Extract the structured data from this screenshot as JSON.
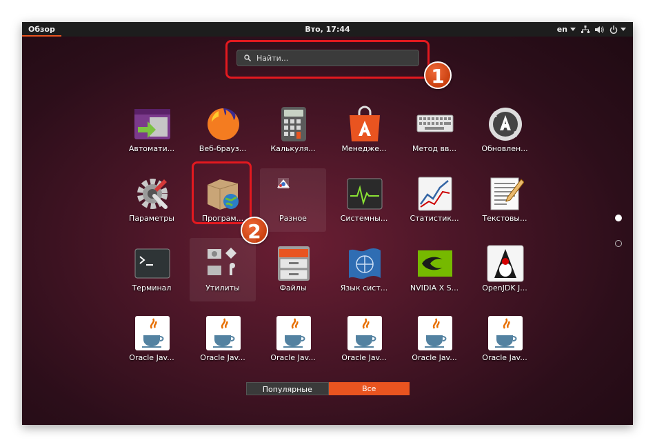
{
  "topbar": {
    "activities": "Обзор",
    "clock": "Вто, 17:44",
    "lang": "en"
  },
  "search": {
    "placeholder": "Найти..."
  },
  "markers": {
    "one": "1",
    "two": "2"
  },
  "apps": [
    {
      "label": "Автомати...",
      "icon": "settings-switcher-icon"
    },
    {
      "label": "Веб-брауз...",
      "icon": "firefox-icon"
    },
    {
      "label": "Калькуля...",
      "icon": "calculator-icon"
    },
    {
      "label": "Менедже...",
      "icon": "software-center-icon"
    },
    {
      "label": "Метод вв...",
      "icon": "keyboard-icon"
    },
    {
      "label": "Обновлен...",
      "icon": "software-updater-icon"
    },
    {
      "label": "Параметры",
      "icon": "settings-gear-icon"
    },
    {
      "label": "Програм...",
      "icon": "software-properties-icon"
    },
    {
      "label": "Разное",
      "icon": "folder-misc-icon"
    },
    {
      "label": "Системны...",
      "icon": "system-monitor-icon"
    },
    {
      "label": "Статистик...",
      "icon": "power-statistics-icon"
    },
    {
      "label": "Текстовы...",
      "icon": "text-editor-icon"
    },
    {
      "label": "Терминал",
      "icon": "terminal-icon"
    },
    {
      "label": "Утилиты",
      "icon": "folder-utilities-icon"
    },
    {
      "label": "Файлы",
      "icon": "files-icon"
    },
    {
      "label": "Язык сист...",
      "icon": "language-support-icon"
    },
    {
      "label": "NVIDIA X S...",
      "icon": "nvidia-icon"
    },
    {
      "label": "OpenJDK J...",
      "icon": "openjdk-icon"
    },
    {
      "label": "Oracle Jav...",
      "icon": "java-icon"
    },
    {
      "label": "Oracle Jav...",
      "icon": "java-icon"
    },
    {
      "label": "Oracle Jav...",
      "icon": "java-icon"
    },
    {
      "label": "Oracle Jav...",
      "icon": "java-icon"
    },
    {
      "label": "Oracle Jav...",
      "icon": "java-icon"
    },
    {
      "label": "Oracle Jav...",
      "icon": "java-icon"
    }
  ],
  "tabs": {
    "frequent": "Популярные",
    "all": "Все"
  },
  "colors": {
    "accent": "#e95420",
    "highlight": "#e3191f"
  }
}
